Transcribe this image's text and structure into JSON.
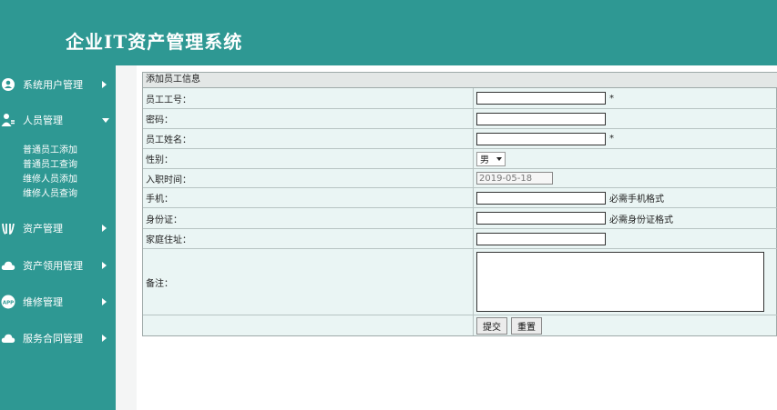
{
  "header": {
    "title": "企业IT资产管理系统"
  },
  "sidebar": {
    "items": [
      {
        "label": "系统用户管理",
        "icon": "user-circle-icon"
      },
      {
        "label": "人员管理",
        "icon": "person-icon"
      },
      {
        "label": "资产管理",
        "icon": "asset-icon"
      },
      {
        "label": "资产领用管理",
        "icon": "cloud-icon"
      },
      {
        "label": "维修管理",
        "icon": "app-badge-icon"
      },
      {
        "label": "服务合同管理",
        "icon": "cloud-icon"
      }
    ],
    "submenu": [
      {
        "label": "普通员工添加"
      },
      {
        "label": "普通员工查询"
      },
      {
        "label": "维修人员添加"
      },
      {
        "label": "维修人员查询"
      }
    ],
    "app_badge_text": "APP"
  },
  "form": {
    "title": "添加员工信息",
    "fields": {
      "employee_id": {
        "label": "员工工号：",
        "value": "",
        "required_mark": "*"
      },
      "password": {
        "label": "密码：",
        "value": ""
      },
      "name": {
        "label": "员工姓名：",
        "value": "",
        "required_mark": "*"
      },
      "gender": {
        "label": "性别：",
        "value": "男"
      },
      "hire_date": {
        "label": "入职时间：",
        "value": "2019-05-18"
      },
      "phone": {
        "label": "手机：",
        "value": "",
        "hint": "必需手机格式"
      },
      "id_card": {
        "label": "身份证：",
        "value": "",
        "hint": "必需身份证格式"
      },
      "address": {
        "label": "家庭住址：",
        "value": ""
      },
      "remark": {
        "label": "备注：",
        "value": ""
      }
    },
    "buttons": {
      "submit": "提交",
      "reset": "重置"
    }
  },
  "colors": {
    "teal": "#2e9893",
    "form_bg": "#eaf5f4",
    "border": "#b7c4c3"
  }
}
